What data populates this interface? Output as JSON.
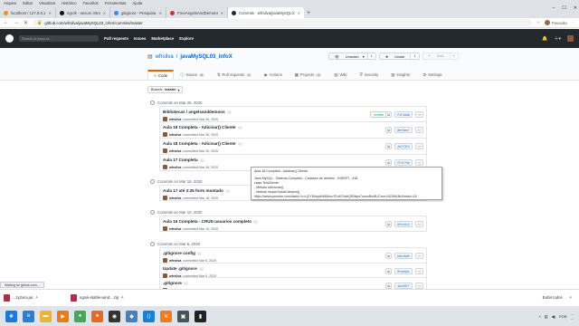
{
  "menubar": [
    "Arquivo",
    "Editar",
    "Visualizar",
    "Histórico",
    "Favoritos",
    "Ferramentas",
    "Ajuda"
  ],
  "tabs": [
    {
      "title": "localhost / 127.0.0.1 / dbinfox",
      "fav": "#f29111",
      "active": false
    },
    {
      "title": "ngrok - secure introspectable t...",
      "fav": "#111",
      "active": false
    },
    {
      "title": "gitignore - Pesquisa Google",
      "fav": "#4285f4",
      "active": false
    },
    {
      "title": "FreeAngelsAndDemons downloa...",
      "fav": "#cc3333",
      "active": false
    },
    {
      "title": "Commits · wfrsilva/javaMySQL01_inf...",
      "fav": "#24292e",
      "active": true
    }
  ],
  "address": {
    "url": "github.com/wfrsilva/javaMySQL03_infoX/commits/master",
    "profile": "Pausada"
  },
  "gh": {
    "search_placeholder": "Search or jump to...",
    "nav": [
      "Pull requests",
      "Issues",
      "Marketplace",
      "Explore"
    ]
  },
  "repo": {
    "owner": "wfrsilva",
    "name": "javaMySQL03_infoX",
    "unwatch": "Unwatch",
    "unwatch_count": "1",
    "star": "Unstar",
    "star_count": "1",
    "fork": "Fork",
    "fork_count": "0",
    "tabs": [
      {
        "label": "Code",
        "badge": "",
        "selected": true
      },
      {
        "label": "Issues",
        "badge": "0",
        "selected": false
      },
      {
        "label": "Pull requests",
        "badge": "0",
        "selected": false
      },
      {
        "label": "Actions",
        "badge": "",
        "selected": false
      },
      {
        "label": "Projects",
        "badge": "0",
        "selected": false
      },
      {
        "label": "Wiki",
        "badge": "",
        "selected": false
      },
      {
        "label": "Security",
        "badge": "",
        "selected": false
      },
      {
        "label": "Insights",
        "badge": "",
        "selected": false
      },
      {
        "label": "Settings",
        "badge": "",
        "selected": false
      }
    ]
  },
  "branch": {
    "label": "Branch:",
    "value": "master"
  },
  "groups": [
    {
      "date": "Commits on Mar 26, 2020",
      "commits": [
        {
          "title": "Bibliotecas / angelsanddemons",
          "user": "wfrsilva",
          "when": "committed Mar 26, 2020",
          "sha": "f1f4dd9",
          "verified": "Verified"
        },
        {
          "title": "Aula 18 Completa - Adicinar() Cliente",
          "user": "wfrsilva",
          "when": "committed Mar 26, 2020",
          "sha": "8ef9ee7",
          "verified": ""
        },
        {
          "title": "Aula 18 Completa - Adicinar() Cliente",
          "user": "wfrsilva",
          "when": "committed Mar 26, 2020",
          "sha": "2d7f3f4",
          "verified": ""
        },
        {
          "title": "Aula 17 Completa",
          "user": "wfrsilva",
          "when": "committed Mar 26, 2020",
          "sha": "ff1f7bb",
          "verified": ""
        }
      ]
    },
    {
      "date": "Commits on Mar 18, 2020",
      "commits": [
        {
          "title": "Aula 17 até 3:25 form montado",
          "user": "wfrsilva",
          "when": "committed Mar 18, 2020",
          "sha": "",
          "verified": ""
        }
      ]
    },
    {
      "date": "Commits on Mar 10, 2020",
      "commits": [
        {
          "title": "Aula 16 Completa - CRUD usuarios completo",
          "user": "wfrsilva",
          "when": "committed Mar 10, 2020",
          "sha": "6f5c913",
          "verified": ""
        }
      ]
    },
    {
      "date": "Commits on Mar 5, 2020",
      "commits": [
        {
          "title": ".gitignore config",
          "user": "wfrsilva",
          "when": "committed Mar 5, 2020",
          "sha": "b8e1b6b",
          "verified": ""
        },
        {
          "title": "Update .gitignore",
          "user": "wfrsilva",
          "when": "committed Mar 5, 2020",
          "sha": "8fde9d1",
          "verified": ""
        },
        {
          "title": ".gitignore",
          "user": "wfrsilva",
          "when": "committed Mar 5, 2020",
          "sha": "1dc09f7",
          "verified": ""
        }
      ]
    }
  ],
  "tooltip": [
    "Aula 18 Completa - Adicinar() Cliente",
    "",
    "Java MySQL - Sistema Completo - Cadastro de clientes - INSERT - #18",
    "class TelaCliente",
    "- Metodo adicionar()",
    "- Metodo limparTodosCampos()",
    "https://www.youtube.com/watch?v=LjZYWsppMr8&list=PLbEOwbQR9lqw7uenuBwNUCxnnV4Z4MUltr&index=18"
  ],
  "statusbar": "Waiting for github.com...",
  "downloads": [
    {
      "name": "...zy2xmi.jar"
    },
    {
      "name": "ngrok-stable-wind....zip"
    }
  ],
  "downloads_right": {
    "show_all": "Exibir todos",
    "close": "×"
  },
  "taskbar": {
    "icons": [
      {
        "name": "start-icon",
        "color": "#1e78d6",
        "glyph": "❖"
      },
      {
        "name": "ie-icon",
        "color": "#2a7fd4",
        "glyph": "e"
      },
      {
        "name": "folder-icon",
        "color": "#e8b53a",
        "glyph": "▬"
      },
      {
        "name": "media-icon",
        "color": "#e97b14",
        "glyph": "▶"
      },
      {
        "name": "chrome-icon",
        "color": "#4aa55a",
        "glyph": "●"
      },
      {
        "name": "firefox-icon",
        "color": "#e66a1f",
        "glyph": "●"
      },
      {
        "name": "obs-icon",
        "color": "#333",
        "glyph": "◉"
      },
      {
        "name": "netbeans-icon",
        "color": "#4b7fb8",
        "glyph": "◆"
      },
      {
        "name": "vscode-icon",
        "color": "#1f7fce",
        "glyph": "⟨⟩"
      },
      {
        "name": "xampp-icon",
        "color": "#f07c1b",
        "glyph": "✕"
      },
      {
        "name": "putty-icon",
        "color": "#455",
        "glyph": "▣"
      },
      {
        "name": "terminal-icon",
        "color": "#222",
        "glyph": "▮"
      }
    ],
    "lang": "POR",
    "time": "...",
    "date": "..."
  }
}
